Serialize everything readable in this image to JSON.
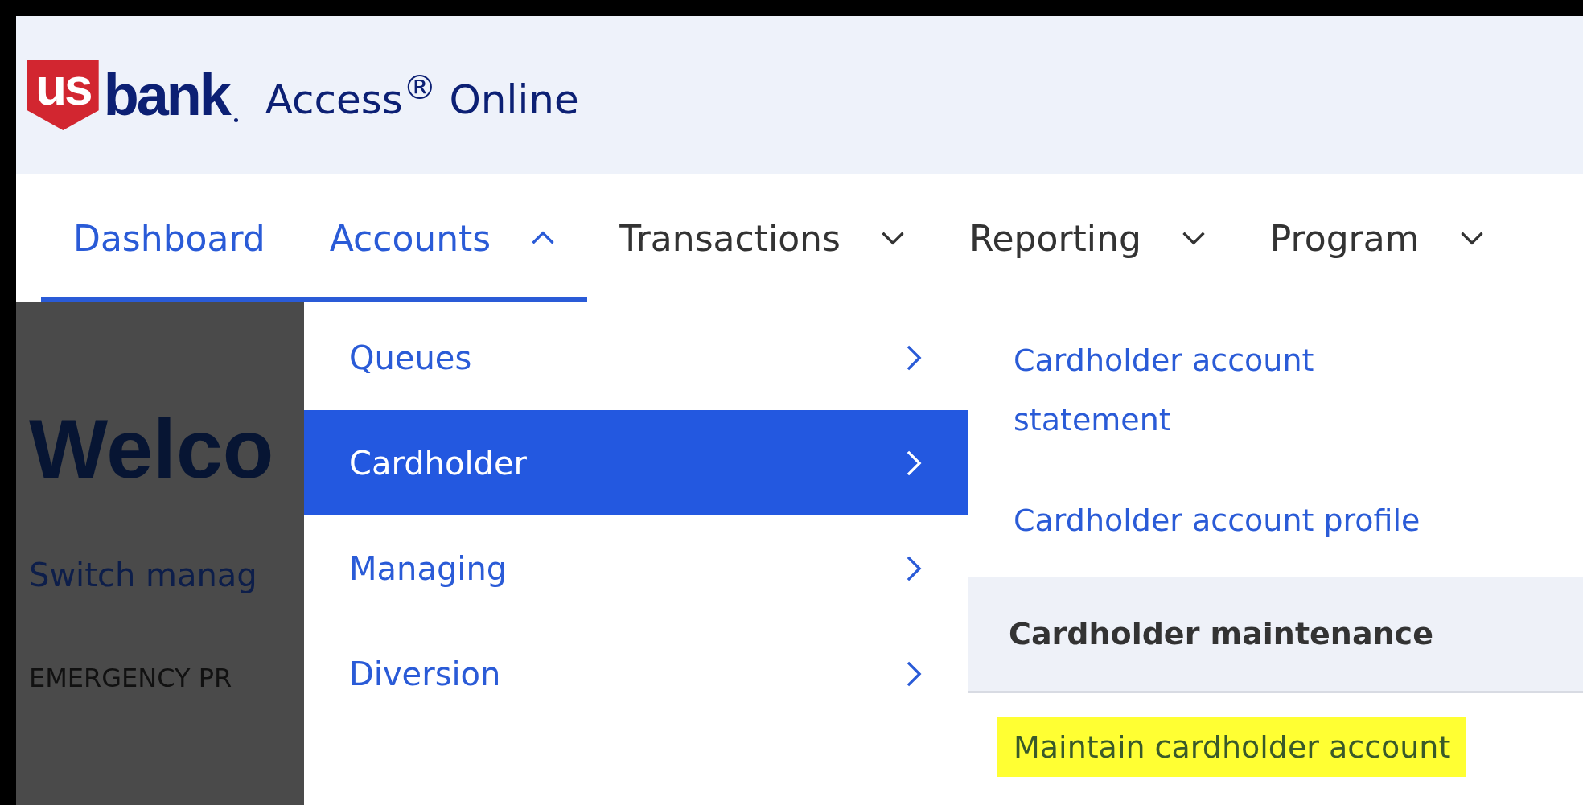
{
  "logo": {
    "mark": "us",
    "name": "bank"
  },
  "app_title": "Access$^{®}$ Online",
  "nav": [
    {
      "label": "Dashboard",
      "selected": true
    },
    {
      "label": "Accounts",
      "selected": true,
      "expanded": true
    },
    {
      "label": "Transactions",
      "selected": false,
      "expanded": false
    },
    {
      "label": "Reporting",
      "selected": false,
      "expanded": false
    },
    {
      "label": "Program",
      "selected": false,
      "expanded": false
    }
  ],
  "background_page": {
    "heading": "Welco",
    "link": "Switch manag",
    "label": "EMERGENCY PR"
  },
  "menu": [
    {
      "label": "Queues",
      "selected": false
    },
    {
      "label": "Cardholder",
      "selected": true
    },
    {
      "label": "Managing",
      "selected": false
    },
    {
      "label": "Diversion",
      "selected": false
    }
  ],
  "submenu": [
    {
      "kind": "link",
      "label": "Cardholder account statement",
      "highlighted": false
    },
    {
      "kind": "link",
      "label": "Cardholder account profile",
      "highlighted": false
    },
    {
      "kind": "heading",
      "label": "Cardholder maintenance"
    },
    {
      "kind": "link",
      "label": "Maintain cardholder account",
      "highlighted": true
    }
  ]
}
